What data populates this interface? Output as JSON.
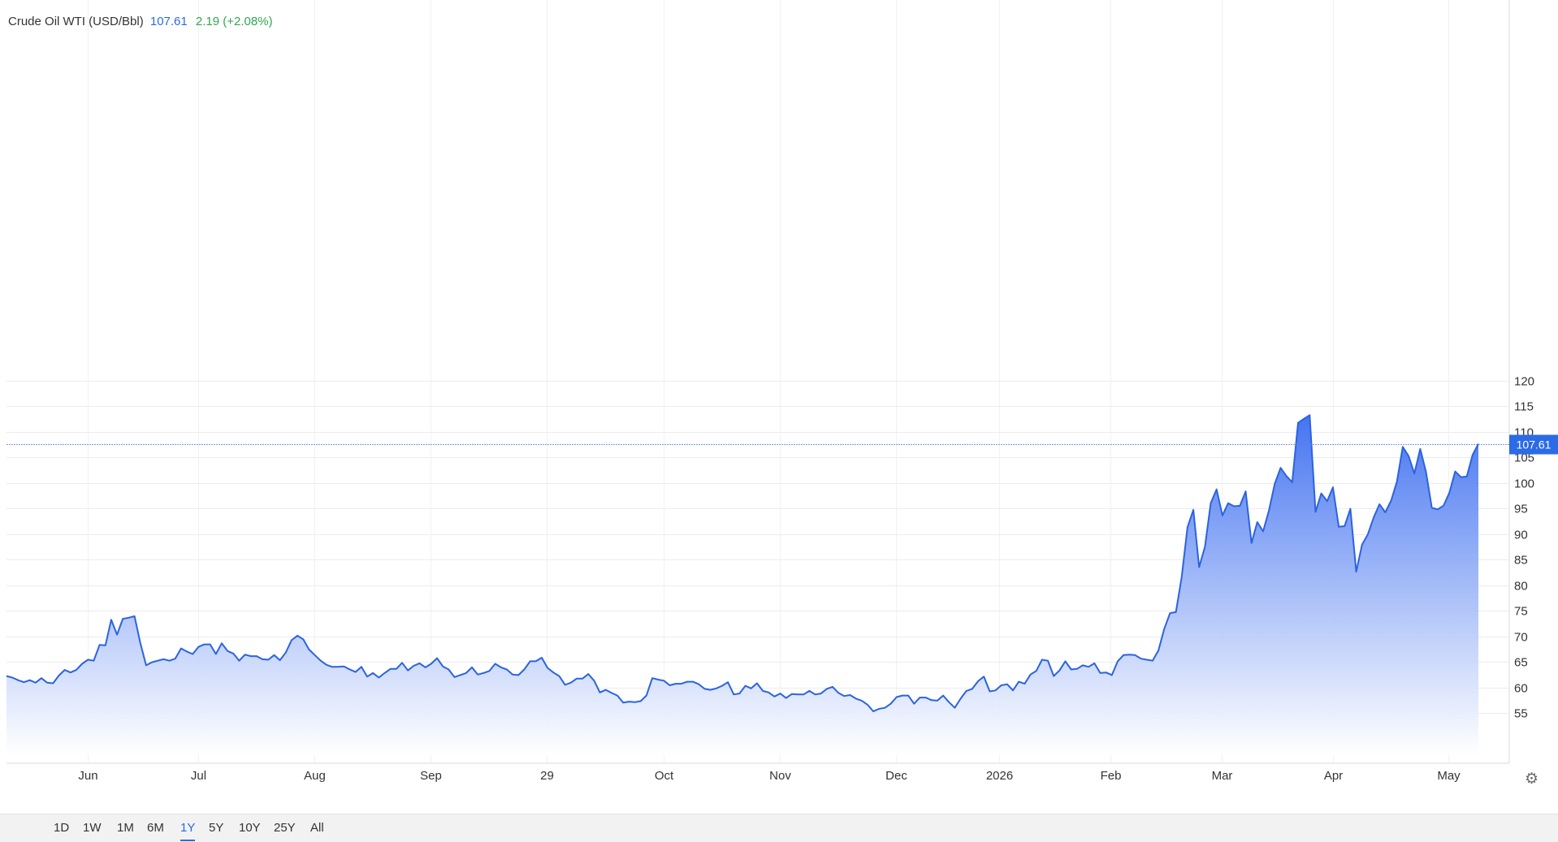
{
  "header": {
    "instrument": "Crude Oil WTI (USD/Bbl)",
    "last": "107.61",
    "change": "2.19 (+2.08%)"
  },
  "price_tag": "107.61",
  "range_buttons": [
    "1D",
    "1W",
    "1M",
    "6M",
    "1Y",
    "5Y",
    "10Y",
    "25Y",
    "All"
  ],
  "active_range": "1Y",
  "icons": {
    "settings": "gear-icon"
  },
  "colors": {
    "line": "#2b63e0",
    "area_top": "#3b6df0",
    "area_bottom": "#ffffff",
    "price_tag": "#2b6be6",
    "change_up": "#2fa84f"
  },
  "chart_data": {
    "type": "area",
    "title": "Crude Oil WTI (USD/Bbl)",
    "ylim": [
      50.5,
      123
    ],
    "y_ticks": [
      55,
      60,
      65,
      70,
      75,
      80,
      85,
      90,
      95,
      100,
      105,
      110,
      115,
      120
    ],
    "x_tick_labels": [
      "Jun",
      "Jul",
      "Aug",
      "Sep",
      "29",
      "Oct",
      "Nov",
      "Dec",
      "2026",
      "Feb",
      "Mar",
      "Apr",
      "May"
    ],
    "last_value": 107.61,
    "grid": true,
    "series": [
      {
        "values": [
          62.2,
          61.9,
          61.4,
          61.0,
          61.4,
          60.9,
          61.8,
          60.9,
          60.8,
          62.3,
          63.4,
          62.9,
          63.4,
          64.6,
          65.4,
          65.2,
          68.3,
          68.2,
          73.2,
          70.3,
          73.4,
          73.6,
          73.9,
          68.7,
          64.3,
          64.9,
          65.2,
          65.5,
          65.2,
          65.6,
          67.6,
          67.0,
          66.5,
          67.9,
          68.4,
          68.4,
          66.5,
          68.6,
          67.1,
          66.6,
          65.2,
          66.4,
          66.1,
          66.1,
          65.5,
          65.4,
          66.3,
          65.3,
          66.8,
          69.2,
          70.1,
          69.4,
          67.4,
          66.3,
          65.2,
          64.4,
          64.0,
          64.0,
          64.1,
          63.5,
          63.0,
          64.0,
          62.1,
          62.8,
          61.9,
          62.8,
          63.6,
          63.6,
          64.8,
          63.3,
          64.2,
          64.7,
          63.9,
          64.6,
          65.7,
          64.1,
          63.5,
          62.0,
          62.4,
          62.8,
          63.9,
          62.5,
          62.8,
          63.2,
          64.6,
          63.9,
          63.5,
          62.5,
          62.4,
          63.5,
          65.1,
          65.1,
          65.8,
          63.8,
          62.9,
          62.2,
          60.5,
          60.9,
          61.7,
          61.7,
          62.6,
          61.3,
          59.0,
          59.5,
          58.9,
          58.4,
          57.0,
          57.2,
          57.1,
          57.3,
          58.4,
          61.8,
          61.5,
          61.3,
          60.4,
          60.7,
          60.7,
          61.1,
          61.1,
          60.6,
          59.7,
          59.5,
          59.8,
          60.3,
          61.0,
          58.6,
          58.8,
          60.3,
          59.8,
          60.8,
          59.3,
          59.0,
          58.2,
          58.8,
          57.9,
          58.7,
          58.6,
          58.6,
          59.3,
          58.6,
          58.8,
          59.7,
          60.1,
          58.9,
          58.3,
          58.5,
          57.8,
          57.4,
          56.6,
          55.3,
          55.8,
          56.0,
          56.8,
          58.1,
          58.4,
          58.4,
          56.8,
          58.0,
          58.0,
          57.5,
          57.4,
          58.4,
          57.1,
          56.0,
          57.8,
          59.3,
          59.7,
          61.2,
          62.1,
          59.2,
          59.4,
          60.4,
          60.6,
          59.4,
          61.1,
          60.7,
          62.5,
          63.2,
          65.4,
          65.2,
          62.2,
          63.3,
          65.1,
          63.5,
          63.6,
          64.3,
          64.0,
          64.7,
          62.8,
          62.9,
          62.4,
          65.1,
          66.3,
          66.4,
          66.3,
          65.6,
          65.4,
          65.2,
          67.2,
          71.4,
          74.5,
          74.7,
          81.5,
          91.3,
          94.7,
          83.5,
          87.5,
          96.0,
          98.7,
          93.6,
          96.0,
          95.4,
          95.5,
          98.3,
          88.2,
          92.3,
          90.5,
          94.6,
          99.8,
          102.9,
          101.3,
          100.1,
          111.7,
          112.5,
          113.2,
          94.3,
          97.9,
          96.4,
          99.1,
          91.4,
          91.5,
          94.9,
          82.6,
          87.9,
          89.9,
          93.2,
          95.8,
          94.2,
          96.5,
          100.2,
          107.0,
          105.2,
          101.8,
          106.6,
          102.1,
          95.1,
          94.8,
          95.5,
          98.0,
          102.2,
          101.1,
          101.2,
          105.4,
          107.61
        ]
      }
    ]
  }
}
